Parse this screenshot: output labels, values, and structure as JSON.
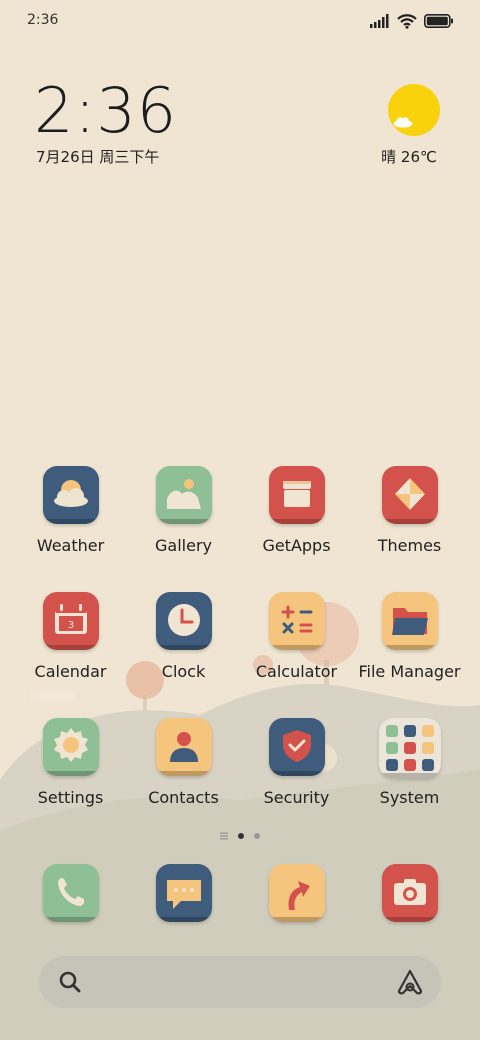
{
  "status_bar": {
    "time": "2:36",
    "icons": [
      "signal-icon",
      "wifi-icon",
      "battery-icon"
    ]
  },
  "clock_widget": {
    "time": "2:36",
    "date": "7月26日 周三下午"
  },
  "weather_widget": {
    "icon": "sun-cloud-icon",
    "text": "晴 26℃"
  },
  "apps": [
    {
      "label": "Weather",
      "icon": "weather-icon",
      "color": "#3f5c7c"
    },
    {
      "label": "Gallery",
      "icon": "gallery-icon",
      "color": "#8fbf95"
    },
    {
      "label": "GetApps",
      "icon": "getapps-icon",
      "color": "#d4524c"
    },
    {
      "label": "Themes",
      "icon": "themes-icon",
      "color": "#d4524c"
    },
    {
      "label": "Calendar",
      "icon": "calendar-icon",
      "color": "#d4524c",
      "day": "3"
    },
    {
      "label": "Clock",
      "icon": "clock-icon",
      "color": "#3f5c7c"
    },
    {
      "label": "Calculator",
      "icon": "calculator-icon",
      "color": "#f5c57e"
    },
    {
      "label": "File Manager",
      "icon": "file-manager-icon",
      "color": "#f5c57e"
    },
    {
      "label": "Settings",
      "icon": "settings-icon",
      "color": "#8fbf95"
    },
    {
      "label": "Contacts",
      "icon": "contacts-icon",
      "color": "#f5c57e"
    },
    {
      "label": "Security",
      "icon": "security-icon",
      "color": "#3f5c7c"
    },
    {
      "label": "System",
      "icon": "system-folder-icon",
      "color": "#ece6da"
    }
  ],
  "page_indicator": {
    "pages": 2,
    "current": 1
  },
  "dock": [
    {
      "icon": "phone-icon",
      "color": "#8fbf95"
    },
    {
      "icon": "messages-icon",
      "color": "#3f5c7c"
    },
    {
      "icon": "browser-icon",
      "color": "#f5c57e"
    },
    {
      "icon": "camera-icon",
      "color": "#d4524c"
    }
  ],
  "search_bar": {
    "left_icon": "search-icon",
    "right_icon": "assistant-icon"
  }
}
